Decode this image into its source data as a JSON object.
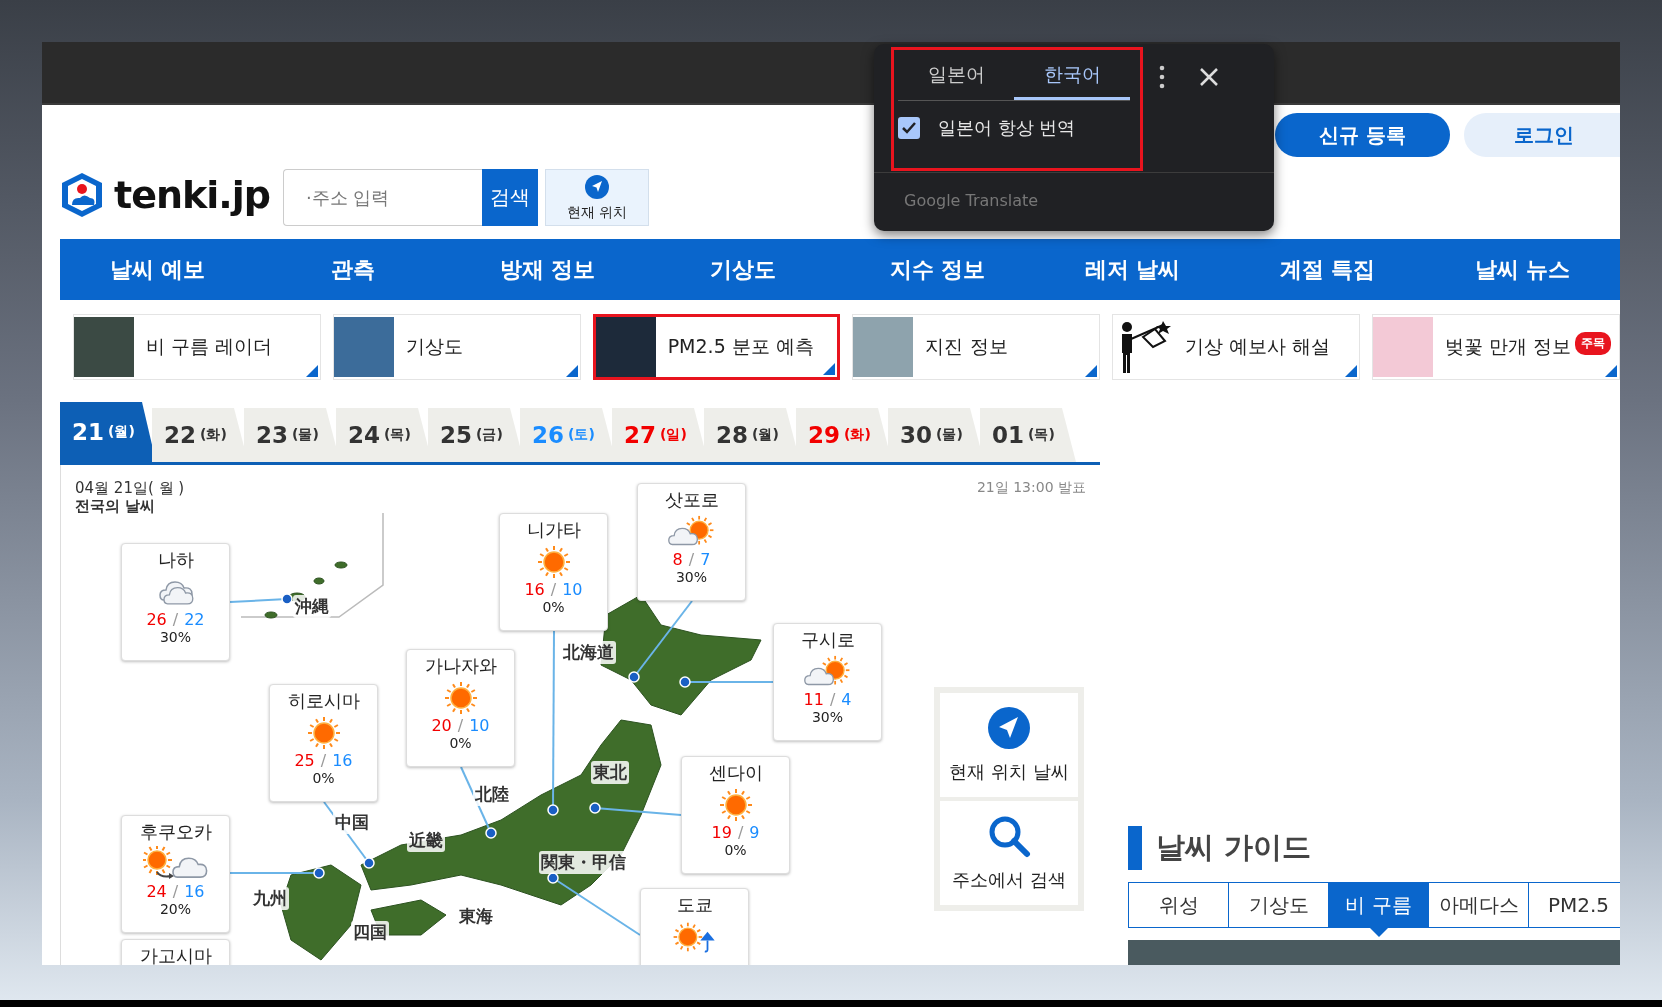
{
  "translate_popup": {
    "tabs": [
      {
        "label": "일본어",
        "selected": false
      },
      {
        "label": "한국어",
        "selected": true
      }
    ],
    "always_translate": {
      "label": "일본어 항상 번역",
      "checked": true
    },
    "footer": "Google Translate"
  },
  "header": {
    "signup_button": "신규 등록",
    "login_button": "로그인",
    "logo": "tenki.jp",
    "search": {
      "placeholder": "·주소 입력",
      "button": "검색"
    },
    "location_button": "현재 위치"
  },
  "nav": [
    "날씨 예보",
    "관측",
    "방재 정보",
    "기상도",
    "지수 정보",
    "레저 날씨",
    "계절 특집",
    "날씨 뉴스"
  ],
  "quick_links": [
    {
      "label": "비 구름 레이더",
      "kind": "map",
      "outlined": false
    },
    {
      "label": "기상도",
      "kind": "map",
      "outlined": false
    },
    {
      "label": "PM2.5 분포 예측",
      "kind": "map",
      "outlined": true
    },
    {
      "label": "지진 정보",
      "kind": "map",
      "outlined": false
    },
    {
      "label": "기상 예보사 해설",
      "kind": "pictogram",
      "outlined": false
    },
    {
      "label": "벚꽃 만개 정보",
      "kind": "photo",
      "outlined": false,
      "badge": "주목"
    }
  ],
  "date_tabs": [
    {
      "day": "21",
      "weekday": "(월)",
      "selected": true,
      "kind": "weekday"
    },
    {
      "day": "22",
      "weekday": "(화)",
      "selected": false,
      "kind": "weekday"
    },
    {
      "day": "23",
      "weekday": "(물)",
      "selected": false,
      "kind": "weekday"
    },
    {
      "day": "24",
      "weekday": "(목)",
      "selected": false,
      "kind": "weekday"
    },
    {
      "day": "25",
      "weekday": "(금)",
      "selected": false,
      "kind": "weekday"
    },
    {
      "day": "26",
      "weekday": "(토)",
      "selected": false,
      "kind": "saturday"
    },
    {
      "day": "27",
      "weekday": "(일)",
      "selected": false,
      "kind": "holiday"
    },
    {
      "day": "28",
      "weekday": "(월)",
      "selected": false,
      "kind": "weekday"
    },
    {
      "day": "29",
      "weekday": "(화)",
      "selected": false,
      "kind": "holiday"
    },
    {
      "day": "30",
      "weekday": "(물)",
      "selected": false,
      "kind": "weekday"
    },
    {
      "day": "01",
      "weekday": "(목)",
      "selected": false,
      "kind": "weekday"
    }
  ],
  "forecast_map": {
    "date": "04월 21일( 월 )",
    "subtitle": "전국의 날씨",
    "issued": "21일 13:00 발표",
    "regions": [
      "沖縄",
      "北海道",
      "東北",
      "北陸",
      "中国",
      "近畿",
      "関東・甲信",
      "九州",
      "四国",
      "東海"
    ],
    "cities": [
      {
        "name": "나하",
        "kind": "cloudy",
        "high": "26",
        "sep": "/",
        "low": "22",
        "pop": "30%"
      },
      {
        "name": "니가타",
        "kind": "sunny",
        "high": "16",
        "sep": "/",
        "low": "10",
        "pop": "0%"
      },
      {
        "name": "삿포로",
        "kind": "cloudy_sunny",
        "high": "8",
        "sep": "/",
        "low": "7",
        "pop": "30%"
      },
      {
        "name": "구시로",
        "kind": "cloudy_sunny",
        "high": "11",
        "sep": "/",
        "low": "4",
        "pop": "30%"
      },
      {
        "name": "가나자와",
        "kind": "sunny",
        "high": "20",
        "sep": "/",
        "low": "10",
        "pop": "0%"
      },
      {
        "name": "히로시마",
        "kind": "sunny",
        "high": "25",
        "sep": "/",
        "low": "16",
        "pop": "0%"
      },
      {
        "name": "센다이",
        "kind": "sunny",
        "high": "19",
        "sep": "/",
        "low": "9",
        "pop": "0%"
      },
      {
        "name": "후쿠오카",
        "kind": "sunny_then_cloudy",
        "high": "24",
        "sep": "/",
        "low": "16",
        "pop": "20%"
      },
      {
        "name": "도쿄",
        "kind": "sunny_then_rain"
      },
      {
        "name": "가고시마"
      }
    ]
  },
  "side_buttons": [
    {
      "label": "현재 위치 날씨",
      "kind": "location"
    },
    {
      "label": "주소에서 검색",
      "kind": "search"
    }
  ],
  "weather_guide": {
    "title": "날씨 가이드",
    "tabs": [
      {
        "label": "위성",
        "selected": false
      },
      {
        "label": "기상도",
        "selected": false
      },
      {
        "label": "비 구름",
        "selected": true
      },
      {
        "label": "아메다스",
        "selected": false
      },
      {
        "label": "PM2.5",
        "selected": false
      }
    ]
  }
}
